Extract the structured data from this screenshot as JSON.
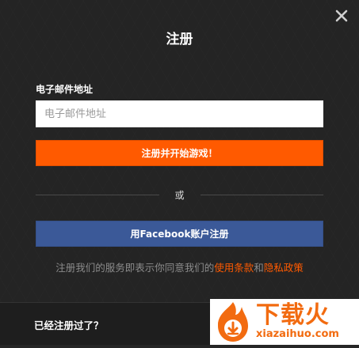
{
  "dialog": {
    "title": "注册",
    "close_icon": "close-icon"
  },
  "form": {
    "email_label": "电子邮件地址",
    "email_placeholder": "电子邮件地址",
    "email_value": "",
    "signup_button": "注册并开始游戏！",
    "divider_text": "或",
    "facebook_button": "用Facebook账户注册"
  },
  "terms": {
    "prefix": "注册我们的服务即表示你同意我们的",
    "terms_link": "使用条款",
    "conjunction": "和",
    "privacy_link": "隐私政策"
  },
  "footer": {
    "already_registered": "已经注册过了？"
  },
  "watermark": {
    "brand_cn": "下载火",
    "brand_url": "xiazaihuo.com"
  },
  "colors": {
    "accent": "#ff5a00",
    "facebook": "#3b5998",
    "background": "#2b2b2b",
    "watermark": "#f26b10"
  }
}
